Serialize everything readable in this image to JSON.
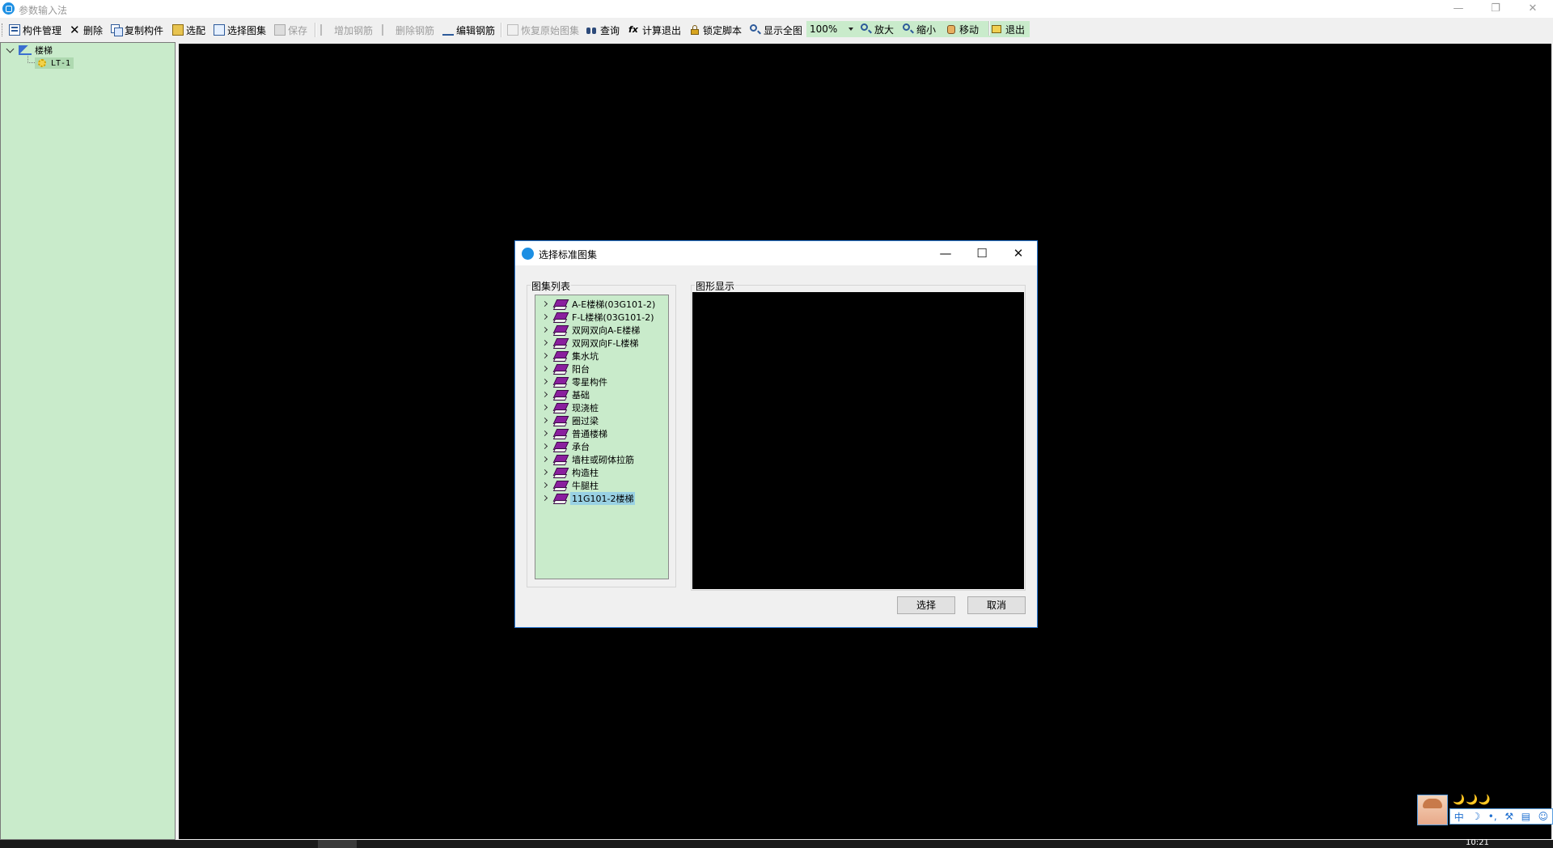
{
  "window": {
    "title": "参数输入法"
  },
  "toolbar": {
    "component_manage": "构件管理",
    "delete": "删除",
    "copy_component": "复制构件",
    "match": "选配",
    "select_atlas": "选择图集",
    "save": "保存",
    "add_rebar": "增加钢筋",
    "delete_rebar": "删除钢筋",
    "edit_rebar": "编辑钢筋",
    "restore_atlas": "恢复原始图集",
    "query": "查询",
    "calc_exit": "计算退出",
    "lock_script": "锁定脚本",
    "show_all": "显示全图",
    "zoom_value": "100%",
    "zoom_in": "放大",
    "zoom_out": "缩小",
    "move": "移动",
    "exit": "退出"
  },
  "tree": {
    "root": "楼梯",
    "child": "LT-1"
  },
  "dialog": {
    "title": "选择标准图集",
    "list_caption": "图集列表",
    "preview_caption": "图形显示",
    "items": [
      "A-E楼梯(03G101-2)",
      "F-L楼梯(03G101-2)",
      "双网双向A-E楼梯",
      "双网双向F-L楼梯",
      "集水坑",
      "阳台",
      "零星构件",
      "基础",
      "现浇桩",
      "圈过梁",
      "普通楼梯",
      "承台",
      "墙柱或砌体拉筋",
      "构造柱",
      "牛腿柱",
      "11G101-2楼梯"
    ],
    "selected_index": 15,
    "select_btn": "选择",
    "cancel_btn": "取消"
  },
  "ime": {
    "mode": "中",
    "moons": "🌙🌙🌙"
  },
  "status": {
    "clock": "10:21"
  },
  "colors": {
    "panel_green": "#c9ebcb",
    "selection_blue": "#99d1e3",
    "book_purple": "#8a1f9e",
    "canvas": "#000000"
  }
}
